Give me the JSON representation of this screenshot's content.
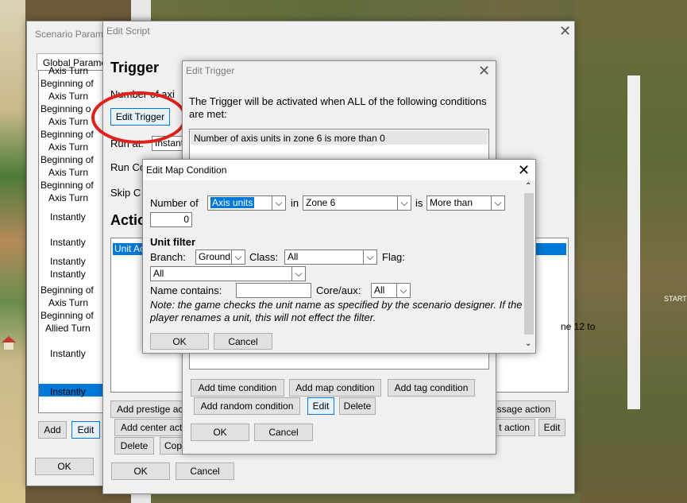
{
  "background": {
    "road_label": "STARTLI",
    "zone_text": "ne 12 to"
  },
  "scenario_params": {
    "title": "Scenario Params",
    "tab": "Global Parame",
    "list_items": [
      "Axis Turn",
      "Beginning of",
      "Axis Turn",
      "Beginning o",
      "Axis Turn",
      "Beginning of",
      "Axis Turn",
      "Beginning of",
      "Axis Turn",
      "Beginning of",
      "Axis Turn",
      "Instantly",
      "Instantly",
      "Instantly",
      "Instantly",
      "Beginning of",
      "Axis Turn",
      "Beginning of",
      "Allied Turn",
      "Instantly",
      "Instantly",
      "Instantly"
    ],
    "add_label": "Add",
    "edit_label": "Edit",
    "ok_label": "OK"
  },
  "edit_script": {
    "title": "Edit Script",
    "trigger_heading": "Trigger",
    "number_of_axis": "Number of axi",
    "edit_trigger_label": "Edit Trigger",
    "run_at": "Run at:",
    "run_at_value": "Instant",
    "run_co": "Run Co",
    "skip_c": "Skip C",
    "actions_heading": "Actio",
    "action_row": "Unit Ac",
    "add_prestige": "Add prestige act",
    "add_center": "Add center act",
    "delete_label": "Delete",
    "copy_label": "Copy",
    "message_action": "essage action",
    "t_action": "t action",
    "edit_label": "Edit",
    "ok_label": "OK",
    "cancel_label": "Cancel"
  },
  "edit_trigger": {
    "title": "Edit Trigger",
    "description": "The Trigger will be activated when ALL of the following conditions are met:",
    "condition": "Number of axis units in zone 6 is more than 0",
    "add_time": "Add time condition",
    "add_map": "Add map condition",
    "add_tag": "Add tag condition",
    "add_random": "Add random condition",
    "edit_label": "Edit",
    "delete_label": "Delete",
    "ok_label": "OK",
    "cancel_label": "Cancel"
  },
  "edit_map_condition": {
    "title": "Edit Map Condition",
    "number_of": "Number of",
    "unit_type": "Axis units",
    "in_label": "in",
    "zone": "Zone 6",
    "is_label": "is",
    "comparison": "More than",
    "value": "0",
    "unit_filter": "Unit filter",
    "branch_label": "Branch:",
    "branch_value": "Ground",
    "class_label": "Class:",
    "class_value": "All",
    "flag_label": "Flag:",
    "flag_value": "All",
    "name_contains": "Name contains:",
    "name_value": "",
    "core_aux_label": "Core/aux:",
    "core_aux_value": "All",
    "note": "Note: the game checks the unit name as specified by the scenario designer. If the player renames a unit, this will not effect the filter.",
    "ok_label": "OK",
    "cancel_label": "Cancel"
  },
  "colors": {
    "highlight": "#0078d7",
    "annotation": "#e0201a"
  }
}
